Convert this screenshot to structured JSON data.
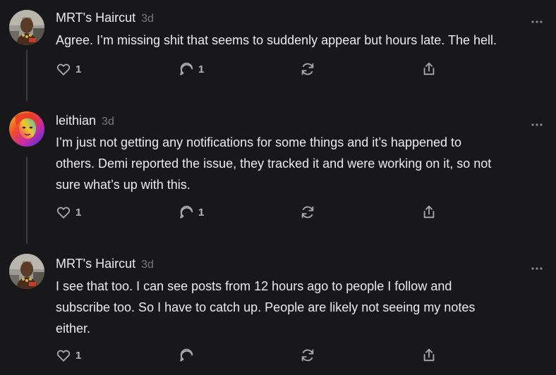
{
  "comments": [
    {
      "author": "MRT's Haircut",
      "timestamp": "3d",
      "body": "Agree. I’m missing shit that seems to suddenly appear but hours late. The hell.",
      "likes": "1",
      "replies": "1",
      "avatar_icon": "photo-avatar"
    },
    {
      "author": "leithian",
      "timestamp": "3d",
      "body": "I’m just not getting any notifications for some things and it’s happened to\nothers. Demi reported the issue, they tracked it and were working on it, so not\nsure what’s up with this.",
      "likes": "1",
      "replies": "1",
      "avatar_icon": "rainbow-portrait-avatar"
    },
    {
      "author": "MRT's Haircut",
      "timestamp": "3d",
      "body": "I see that too. I can see posts from 12 hours ago to people I follow and\nsubscribe too. So I have to catch up. People are likely not seeing my notes\neither.",
      "likes": "1",
      "replies": "",
      "avatar_icon": "photo-avatar"
    }
  ],
  "colors": {
    "background": "#18181a",
    "text": "#ececec",
    "muted": "#7a7a7d",
    "icon": "#a9a9ac",
    "thread_line": "#3a3a3d"
  }
}
